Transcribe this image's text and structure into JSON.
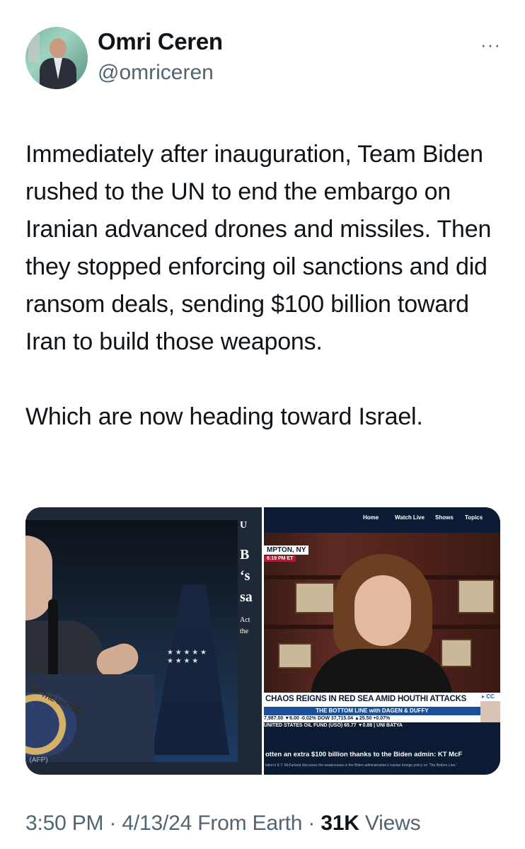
{
  "author": {
    "name": "Omri Ceren",
    "handle": "@omriceren"
  },
  "menu_label": "···",
  "tweet": {
    "text": "Immediately after inauguration, Team Biden rushed to the UN to end the embargo on Iranian advanced drones and missiles. Then they stopped enforcing oil sanctions and did ransom deals, sending $100 billion toward Iran to build those weapons.\n\nWhich are now heading toward Israel."
  },
  "media": {
    "left": {
      "side_letters": [
        "B",
        "‘s",
        "sa"
      ],
      "side_small": [
        "Act",
        "the"
      ],
      "top_glyph": "U",
      "seal_text": "OF THE UNITED",
      "caption": ". (AFP)"
    },
    "right": {
      "nav": [
        "Home",
        "Watch Live",
        "Shows",
        "Topics"
      ],
      "location": "MPTON, NY",
      "time": "6:19 PM ET",
      "headline": "CHAOS REIGNS IN RED SEA AMID HOUTHI ATTACKS",
      "cc": "▸ CC",
      "show": "THE BOTTOM LINE with DAGEN & DUFFY",
      "ticker1": "7,987.00 ▼6.00 -0.02% DOW 37,715.04 ▲25.50 +0.07%",
      "ticker2": "UNITED STATES OIL FUND (USO) 65.77 ▼0.88 | UNI BATYA",
      "lower_third": "otten an extra $100 billion thanks to the Biden admin: KT McF",
      "subtitle": "lation's K.T. McFarland discusses the weaknesses in the Biden administration's Iranian foreign policy on 'The Bottom Line.'"
    }
  },
  "footer": {
    "time": "3:50 PM",
    "sep1": " · ",
    "date": "4/13/24",
    "source": " From Earth",
    "sep2": " · ",
    "views_count": "31K",
    "views_label": " Views"
  }
}
